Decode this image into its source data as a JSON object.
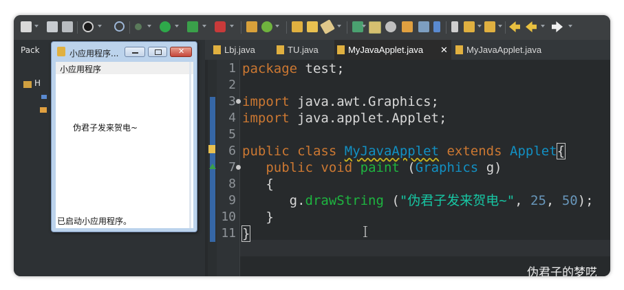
{
  "left_panel": {
    "tab_label": "Pack",
    "tree_label": "H"
  },
  "editor_tabs": [
    {
      "label": "Lbj.java"
    },
    {
      "label": "TU.java"
    },
    {
      "label": "MyJavaApplet.java"
    },
    {
      "label": "MyJavaApplet.java"
    }
  ],
  "close_glyph": "✕",
  "line_numbers": [
    "1",
    "2",
    "3",
    "4",
    "5",
    "6",
    "7",
    "8",
    "9",
    "10",
    "11"
  ],
  "code": {
    "l1_kw": "package",
    "l1_rest": " test;",
    "l3_kw": "import",
    "l3_rest": " java.awt.Graphics;",
    "l4_kw": "import",
    "l4_rest": " java.applet.Applet;",
    "l6_kw1": "public",
    "l6_kw2": "class",
    "l6_class": "MyJavaApplet",
    "l6_kw3": "extends",
    "l6_super": "Applet",
    "l6_brace": "{",
    "l7_kw1": "public",
    "l7_kw2": "void",
    "l7_meth": "paint",
    "l7_paren_open": " (",
    "l7_type": "Graphics",
    "l7_param": " g",
    "l7_paren_close": ")",
    "l8_brace": "{",
    "l9_obj": "g.",
    "l9_meth": "drawString",
    "l9_open": " (",
    "l9_str": "\"伪君子发来贺电~\"",
    "l9_comma1": ", ",
    "l9_n1": "25",
    "l9_comma2": ", ",
    "l9_n2": "50",
    "l9_close": ");",
    "l10_brace": "}",
    "l11_brace": "}"
  },
  "applet_window": {
    "title": "小应用程序...",
    "menu_label": "小应用程序",
    "drawn_text": "伪君子发来贺电~",
    "status": "已启动小应用程序。"
  },
  "watermark": "伪君子的梦呓",
  "colors": {
    "keyword": "#cc7832",
    "type": "#1290c3",
    "method": "#1eb540",
    "string": "#17c6a3",
    "number": "#6897bb",
    "editor_bg": "#272a2c"
  }
}
